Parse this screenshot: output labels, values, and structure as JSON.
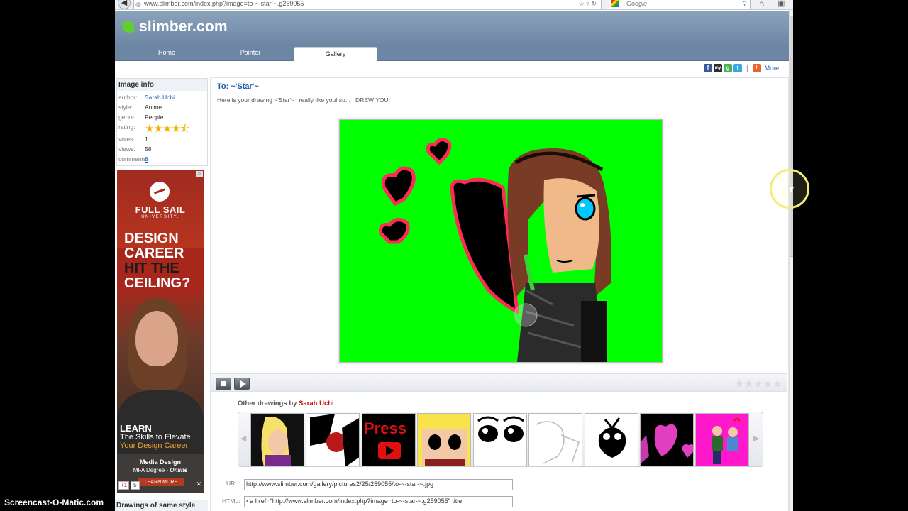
{
  "browser": {
    "url": "www.slimber.com/index.php?image=to-~-star-~.g259055",
    "search_placeholder": "Google"
  },
  "site": {
    "logo": "slimber.com",
    "nav": [
      "Home",
      "Painter",
      "Gallery"
    ],
    "active_tab": "Gallery"
  },
  "share": {
    "more_label": "More",
    "separator": "|"
  },
  "image_info": {
    "heading": "Image info",
    "author_label": "author:",
    "author": "Sarah Uchi",
    "style_label": "style:",
    "style": "Anime",
    "genre_label": "genre:",
    "genre": "People",
    "rating_label": "rating:",
    "rating": 4.5,
    "rating_max": 5,
    "votes_label": "votes:",
    "votes": "1",
    "views_label": "views:",
    "views": "58",
    "comments_label": "comments:",
    "comments": "8"
  },
  "ad": {
    "brand": "FULL SAIL",
    "university": "UNIVERSITY.",
    "headline_1": "DESIGN",
    "headline_2": "CAREER",
    "headline_3": "HIT THE",
    "headline_4": "CEILING?",
    "learn": "LEARN",
    "skills_1": "The Skills to Elevate",
    "skills_2": "Your Design Career",
    "program": "Media Design",
    "degree_prefix": "MFA Degree - ",
    "degree_suffix": "Online",
    "learn_more": "LEARN MORE",
    "gplus": "+1",
    "gplus_count": "5",
    "close": "✕"
  },
  "sidebar_bottom": {
    "heading": "Drawings of same style"
  },
  "drawing": {
    "title_prefix": "To: ",
    "title": "~'Star'~",
    "message": "Here is your drawing ~'Star'~ i really like you! so... I DREW YOU!"
  },
  "player": {
    "rating_empty": "★★★★★"
  },
  "others": {
    "label": "Other drawings by ",
    "author": "Sarah Uchi"
  },
  "links": {
    "url_label": "URL:",
    "url_value": "http://www.slimber.com/gallery/pictures2/25/259055/to-~-star-~.jpg",
    "html_label": "HTML:",
    "html_value": "<a href=\"http://www.slimber.com/index.php?image=to-~-star-~.g259055\" title"
  },
  "watermark": "Screencast-O-Matic.com",
  "colors": {
    "nav_blue": "#6d86a4",
    "link_blue": "#1a5ea8",
    "canvas_green": "#00ff00",
    "star_gold": "#f4b400"
  }
}
